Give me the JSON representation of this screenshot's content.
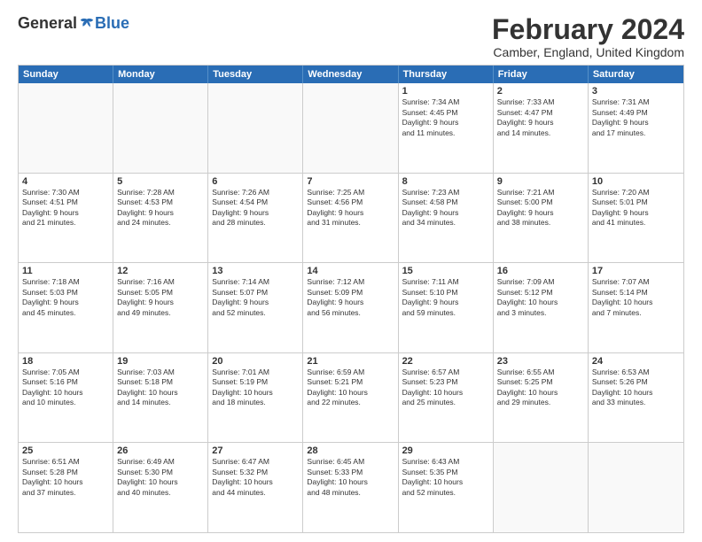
{
  "header": {
    "logo": {
      "general": "General",
      "blue": "Blue"
    },
    "title": "February 2024",
    "location": "Camber, England, United Kingdom"
  },
  "calendar": {
    "weekdays": [
      "Sunday",
      "Monday",
      "Tuesday",
      "Wednesday",
      "Thursday",
      "Friday",
      "Saturday"
    ],
    "rows": [
      [
        {
          "day": "",
          "info": "",
          "empty": true
        },
        {
          "day": "",
          "info": "",
          "empty": true
        },
        {
          "day": "",
          "info": "",
          "empty": true
        },
        {
          "day": "",
          "info": "",
          "empty": true
        },
        {
          "day": "1",
          "info": "Sunrise: 7:34 AM\nSunset: 4:45 PM\nDaylight: 9 hours\nand 11 minutes."
        },
        {
          "day": "2",
          "info": "Sunrise: 7:33 AM\nSunset: 4:47 PM\nDaylight: 9 hours\nand 14 minutes."
        },
        {
          "day": "3",
          "info": "Sunrise: 7:31 AM\nSunset: 4:49 PM\nDaylight: 9 hours\nand 17 minutes."
        }
      ],
      [
        {
          "day": "4",
          "info": "Sunrise: 7:30 AM\nSunset: 4:51 PM\nDaylight: 9 hours\nand 21 minutes."
        },
        {
          "day": "5",
          "info": "Sunrise: 7:28 AM\nSunset: 4:53 PM\nDaylight: 9 hours\nand 24 minutes."
        },
        {
          "day": "6",
          "info": "Sunrise: 7:26 AM\nSunset: 4:54 PM\nDaylight: 9 hours\nand 28 minutes."
        },
        {
          "day": "7",
          "info": "Sunrise: 7:25 AM\nSunset: 4:56 PM\nDaylight: 9 hours\nand 31 minutes."
        },
        {
          "day": "8",
          "info": "Sunrise: 7:23 AM\nSunset: 4:58 PM\nDaylight: 9 hours\nand 34 minutes."
        },
        {
          "day": "9",
          "info": "Sunrise: 7:21 AM\nSunset: 5:00 PM\nDaylight: 9 hours\nand 38 minutes."
        },
        {
          "day": "10",
          "info": "Sunrise: 7:20 AM\nSunset: 5:01 PM\nDaylight: 9 hours\nand 41 minutes."
        }
      ],
      [
        {
          "day": "11",
          "info": "Sunrise: 7:18 AM\nSunset: 5:03 PM\nDaylight: 9 hours\nand 45 minutes."
        },
        {
          "day": "12",
          "info": "Sunrise: 7:16 AM\nSunset: 5:05 PM\nDaylight: 9 hours\nand 49 minutes."
        },
        {
          "day": "13",
          "info": "Sunrise: 7:14 AM\nSunset: 5:07 PM\nDaylight: 9 hours\nand 52 minutes."
        },
        {
          "day": "14",
          "info": "Sunrise: 7:12 AM\nSunset: 5:09 PM\nDaylight: 9 hours\nand 56 minutes."
        },
        {
          "day": "15",
          "info": "Sunrise: 7:11 AM\nSunset: 5:10 PM\nDaylight: 9 hours\nand 59 minutes."
        },
        {
          "day": "16",
          "info": "Sunrise: 7:09 AM\nSunset: 5:12 PM\nDaylight: 10 hours\nand 3 minutes."
        },
        {
          "day": "17",
          "info": "Sunrise: 7:07 AM\nSunset: 5:14 PM\nDaylight: 10 hours\nand 7 minutes."
        }
      ],
      [
        {
          "day": "18",
          "info": "Sunrise: 7:05 AM\nSunset: 5:16 PM\nDaylight: 10 hours\nand 10 minutes."
        },
        {
          "day": "19",
          "info": "Sunrise: 7:03 AM\nSunset: 5:18 PM\nDaylight: 10 hours\nand 14 minutes."
        },
        {
          "day": "20",
          "info": "Sunrise: 7:01 AM\nSunset: 5:19 PM\nDaylight: 10 hours\nand 18 minutes."
        },
        {
          "day": "21",
          "info": "Sunrise: 6:59 AM\nSunset: 5:21 PM\nDaylight: 10 hours\nand 22 minutes."
        },
        {
          "day": "22",
          "info": "Sunrise: 6:57 AM\nSunset: 5:23 PM\nDaylight: 10 hours\nand 25 minutes."
        },
        {
          "day": "23",
          "info": "Sunrise: 6:55 AM\nSunset: 5:25 PM\nDaylight: 10 hours\nand 29 minutes."
        },
        {
          "day": "24",
          "info": "Sunrise: 6:53 AM\nSunset: 5:26 PM\nDaylight: 10 hours\nand 33 minutes."
        }
      ],
      [
        {
          "day": "25",
          "info": "Sunrise: 6:51 AM\nSunset: 5:28 PM\nDaylight: 10 hours\nand 37 minutes."
        },
        {
          "day": "26",
          "info": "Sunrise: 6:49 AM\nSunset: 5:30 PM\nDaylight: 10 hours\nand 40 minutes."
        },
        {
          "day": "27",
          "info": "Sunrise: 6:47 AM\nSunset: 5:32 PM\nDaylight: 10 hours\nand 44 minutes."
        },
        {
          "day": "28",
          "info": "Sunrise: 6:45 AM\nSunset: 5:33 PM\nDaylight: 10 hours\nand 48 minutes."
        },
        {
          "day": "29",
          "info": "Sunrise: 6:43 AM\nSunset: 5:35 PM\nDaylight: 10 hours\nand 52 minutes."
        },
        {
          "day": "",
          "info": "",
          "empty": true
        },
        {
          "day": "",
          "info": "",
          "empty": true
        }
      ]
    ]
  }
}
